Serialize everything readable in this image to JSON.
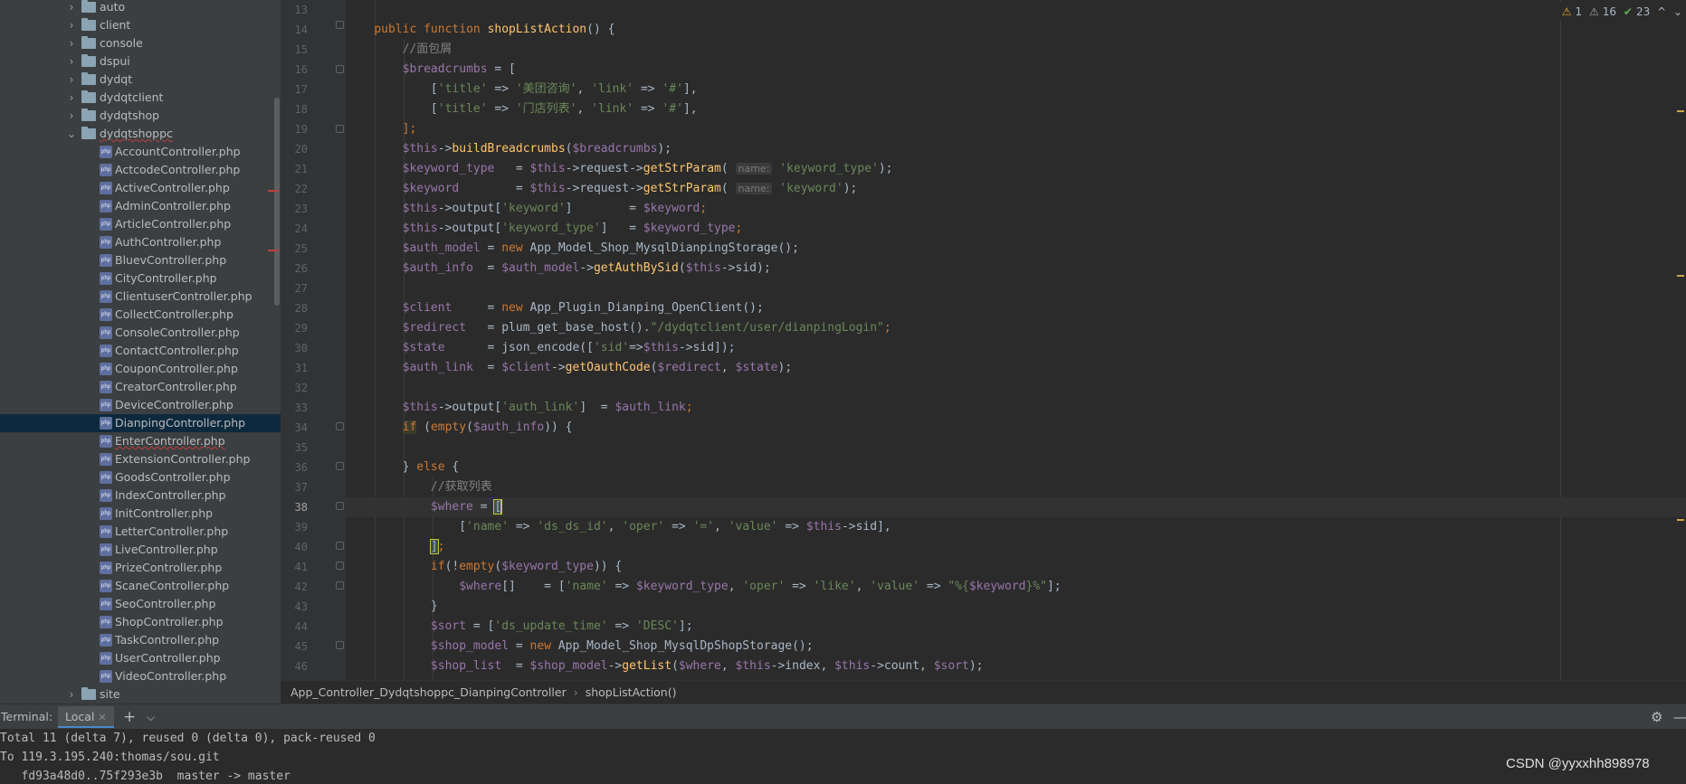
{
  "project_tree": {
    "folders_before": [
      "auto",
      "client",
      "console",
      "dspui",
      "dydqt",
      "dydqtclient",
      "dydqtshop"
    ],
    "expanded_folder": "dydqtshoppc",
    "files": [
      "AccountController.php",
      "ActcodeController.php",
      "ActiveController.php",
      "AdminController.php",
      "ArticleController.php",
      "AuthController.php",
      "BluevController.php",
      "CityController.php",
      "ClientuserController.php",
      "CollectController.php",
      "ConsoleController.php",
      "ContactController.php",
      "CouponController.php",
      "CreatorController.php",
      "DeviceController.php",
      "DianpingController.php",
      "EnterController.php",
      "ExtensionController.php",
      "GoodsController.php",
      "IndexController.php",
      "InitController.php",
      "LetterController.php",
      "LiveController.php",
      "PrizeController.php",
      "ScaneController.php",
      "SeoController.php",
      "ShopController.php",
      "TaskController.php",
      "UserController.php",
      "VideoController.php"
    ],
    "selected_file": "DianpingController.php",
    "folders_after": [
      "site"
    ],
    "file_icon": "php-file-icon",
    "folder_icon": "folder-icon"
  },
  "editor": {
    "line_numbers": [
      "13",
      "14",
      "15",
      "16",
      "17",
      "18",
      "19",
      "20",
      "21",
      "22",
      "23",
      "24",
      "25",
      "26",
      "27",
      "28",
      "29",
      "30",
      "31",
      "32",
      "33",
      "34",
      "35",
      "36",
      "37",
      "38",
      "39",
      "40",
      "41",
      "42",
      "43",
      "44",
      "45",
      "46"
    ],
    "current_line": "38",
    "hint_name": "name:",
    "code": {
      "l14": {
        "k1": "public",
        "k2": "function",
        "fn": "shopListAction",
        "rest": "() {"
      },
      "l15": "//面包屑",
      "l16": {
        "v": "$breadcrumbs",
        "rest": " = ["
      },
      "l17": {
        "open": "[",
        "k1": "'title'",
        "op1": " => ",
        "s1": "'美团咨询'",
        "mid": ", ",
        "k2": "'link'",
        "op2": " => ",
        "s2": "'#'",
        "close": "],"
      },
      "l18": {
        "open": "[",
        "k1": "'title'",
        "op1": " => ",
        "s1": "'门店列表'",
        "mid": ", ",
        "k2": "'link'",
        "op2": " => ",
        "s2": "'#'",
        "close": "],"
      },
      "l19": "];",
      "l20": {
        "v": "$this",
        "arrow": "->",
        "fn": "buildBreadcrumbs",
        "open": "(",
        "arg": "$breadcrumbs",
        "close": ");"
      },
      "l21": {
        "v": "$keyword_type",
        "eq": "   = ",
        "v2": "$this",
        "a1": "->request->",
        "fn": "getStrParam",
        "open": "(",
        "s": "'keyword_type'",
        "close": ");"
      },
      "l22": {
        "v": "$keyword",
        "eq": "        = ",
        "v2": "$this",
        "a1": "->request->",
        "fn": "getStrParam",
        "open": "(",
        "s": "'keyword'",
        "close": ");"
      },
      "l23": {
        "v": "$this",
        "a1": "->output[",
        "s": "'keyword'",
        "a2": "]        = ",
        "v2": "$keyword",
        "end": ";"
      },
      "l24": {
        "v": "$this",
        "a1": "->output[",
        "s": "'keyword_type'",
        "a2": "]   = ",
        "v2": "$keyword_type",
        "end": ";"
      },
      "l25": {
        "v": "$auth_model",
        "eq": " = ",
        "kw": "new",
        "cls": " App_Model_Shop_MysqlDianpingStorage();"
      },
      "l26": {
        "v": "$auth_info",
        "eq": "  = ",
        "v2": "$auth_model",
        "a1": "->",
        "fn": "getAuthBySid",
        "open": "(",
        "v3": "$this",
        "a2": "->sid);"
      },
      "l28": {
        "v": "$client",
        "eq": "     = ",
        "kw": "new",
        "cls": " App_Plugin_Dianping_OpenClient();"
      },
      "l29": {
        "v": "$redirect",
        "eq": "   = ",
        "call": "plum_get_base_host().",
        "s": "\"/dydqtclient/user/dianpingLogin\"",
        "end": ";"
      },
      "l30": {
        "v": "$state",
        "eq": "      = ",
        "call": "json_encode([",
        "s": "'sid'",
        "mid": "=>",
        "v2": "$this",
        "a2": "->sid]);"
      },
      "l31": {
        "v": "$auth_link",
        "eq": "  = ",
        "v2": "$client",
        "a1": "->",
        "fn": "getOauthCode",
        "open": "(",
        "v3": "$redirect",
        "mid": ", ",
        "v4": "$state",
        "close": ");"
      },
      "l33": {
        "v": "$this",
        "a1": "->output[",
        "s": "'auth_link'",
        "a2": "]  = ",
        "v2": "$auth_link",
        "end": ";"
      },
      "l34": {
        "kw": "if",
        "open": " (",
        "kw2": "empty",
        "p": "(",
        "v": "$auth_info",
        "close": ")) {"
      },
      "l36": {
        "open": "} ",
        "kw": "else",
        "close": " {"
      },
      "l37": "//获取列表",
      "l38": {
        "v": "$where",
        "eq": " = ",
        "br": "["
      },
      "l39": {
        "open": "[",
        "s1": "'name'",
        "op1": " => ",
        "s2": "'ds_ds_id'",
        "m1": ", ",
        "s3": "'oper'",
        "op2": " => ",
        "s4": "'='",
        "m2": ", ",
        "s5": "'value'",
        "op3": " => ",
        "v": "$this",
        "a": "->sid],"
      },
      "l40": {
        "br": "]",
        "end": ";"
      },
      "l41": {
        "kw": "if",
        "open": "(!",
        "kw2": "empty",
        "p": "(",
        "v": "$keyword_type",
        "close": ")) {"
      },
      "l42": {
        "v": "$where",
        "eq": "[]    = [",
        "s1": "'name'",
        "op1": " => ",
        "v2": "$keyword_type",
        "m1": ", ",
        "s2": "'oper'",
        "op2": " => ",
        "s3": "'like'",
        "m2": ", ",
        "s4": "'value'",
        "op3": " => ",
        "s5a": "\"%{",
        "v3": "$keyword",
        "s5b": "}%\"",
        "end": "];"
      },
      "l43": "}",
      "l44": {
        "v": "$sort",
        "eq": " = [",
        "s1": "'ds_update_time'",
        "op": " => ",
        "s2": "'DESC'",
        "end": "];"
      },
      "l45": {
        "v": "$shop_model",
        "eq": " = ",
        "kw": "new",
        "cls": " App_Model_Shop_MysqlDpShopStorage();"
      },
      "l46": {
        "v": "$shop_list",
        "eq": "  = ",
        "v2": "$shop_model",
        "a1": "->",
        "fn": "getList",
        "open": "(",
        "v3": "$where",
        "m1": ", ",
        "v4": "$this",
        "a2": "->index, ",
        "v5": "$this",
        "a3": "->count, ",
        "v6": "$sort",
        "close": ");"
      }
    }
  },
  "inspections": {
    "warnings": "1",
    "weak_warnings": "16",
    "typos": "23",
    "warn_icon": "warning-triangle-icon",
    "weak_icon": "weak-warning-icon",
    "ok_icon": "check-icon",
    "chevron_up": "^",
    "chevron_down": "⌄"
  },
  "breadcrumb": {
    "class_name": "App_Controller_Dydqtshoppc_DianpingController",
    "method_name": "shopListAction()"
  },
  "terminal": {
    "label": "Terminal:",
    "tab_label": "Local",
    "lines": [
      "Total 11 (delta 7), reused 0 (delta 0), pack-reused 0",
      "To 119.3.195.240:thomas/sou.git",
      "   fd93a48d0..75f293e3b  master -> master"
    ]
  },
  "watermark": "CSDN @yyxxhh898978"
}
